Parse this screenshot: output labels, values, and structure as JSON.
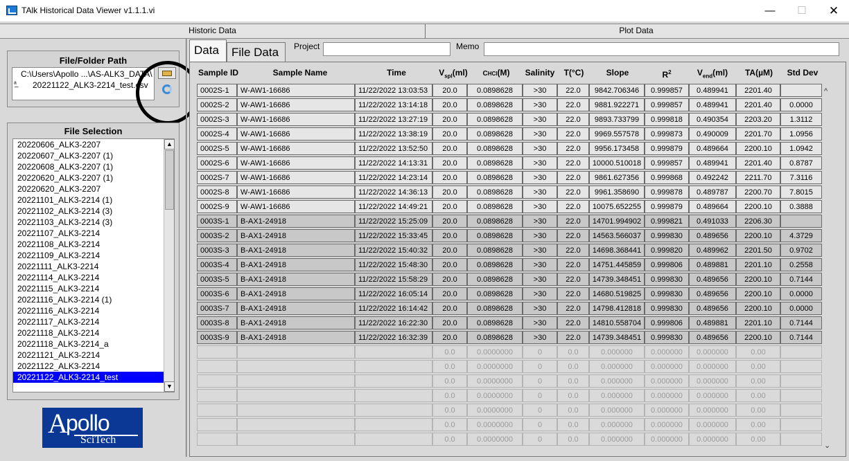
{
  "window": {
    "title": "TAlk Historical Data Viewer v1.1.1.vi",
    "minimize": "—",
    "maximize": "☐",
    "close": "✕"
  },
  "top_tabs": {
    "historic": "Historic Data",
    "plot": "Plot Data"
  },
  "file_path": {
    "title": "File/Folder Path",
    "line1": "C:\\Users\\Apollo ...\\AS-ALK3_DATA\\",
    "line2": "20221122_ALK3-2214_test.csv",
    "glyph": "ᵃ̲"
  },
  "file_selection": {
    "title": "File Selection",
    "items": [
      "20220606_ALK3-2207",
      "20220607_ALK3-2207 (1)",
      "20220608_ALK3-2207 (1)",
      "20220620_ALK3-2207 (1)",
      "20220620_ALK3-2207",
      "20221101_ALK3-2214 (1)",
      "20221102_ALK3-2214 (3)",
      "20221103_ALK3-2214 (3)",
      "20221107_ALK3-2214",
      "20221108_ALK3-2214",
      "20221109_ALK3-2214",
      "20221111_ALK3-2214",
      "20221114_ALK3-2214",
      "20221115_ALK3-2214",
      "20221116_ALK3-2214 (1)",
      "20221116_ALK3-2214",
      "20221117_ALK3-2214",
      "20221118_ALK3-2214",
      "20221118_ALK3-2214_a",
      "20221121_ALK3-2214",
      "20221122_ALK3-2214",
      "20221122_ALK3-2214_test"
    ],
    "selected": "20221122_ALK3-2214_test",
    "scroll_up": "▲",
    "scroll_down": "▼"
  },
  "logo": {
    "a": "A",
    "pollo": "pollo",
    "sci": "SciTech"
  },
  "data_tabs": {
    "data": "Data",
    "file_data": "File Data"
  },
  "fields": {
    "project_label": "Project",
    "project_value": "",
    "memo_label": "Memo",
    "memo_value": ""
  },
  "table": {
    "headers": {
      "sample_id": "Sample ID",
      "sample_name": "Sample Name",
      "time": "Time",
      "vspl_main": "V",
      "vspl_sub": "spl",
      "vspl_unit": "(ml)",
      "chcl_main": "C",
      "chcl_sub": "HCl",
      "chcl_unit": "(M)",
      "salinity": "Salinity",
      "temp": "T(°C)",
      "slope": "Slope",
      "r2_main": "R",
      "r2_sup": "2",
      "vend_main": "V",
      "vend_sub": "end",
      "vend_unit": "(ml)",
      "ta": "TA(µM)",
      "std": "Std Dev"
    },
    "scroll_up": "^",
    "scroll_down": "⌄",
    "rows": [
      {
        "id": "0002S-1",
        "name": "W-AW1-16686",
        "time": "11/22/2022  13:03:53",
        "v": "20.0",
        "c": "0.0898628",
        "sal": ">30",
        "t": "22.0",
        "slope": "9842.706346",
        "r2": "0.999857",
        "vend": "0.489941",
        "ta": "2201.40",
        "std": ""
      },
      {
        "id": "0002S-2",
        "name": "W-AW1-16686",
        "time": "11/22/2022  13:14:18",
        "v": "20.0",
        "c": "0.0898628",
        "sal": ">30",
        "t": "22.0",
        "slope": "9881.922271",
        "r2": "0.999857",
        "vend": "0.489941",
        "ta": "2201.40",
        "std": "0.0000"
      },
      {
        "id": "0002S-3",
        "name": "W-AW1-16686",
        "time": "11/22/2022  13:27:19",
        "v": "20.0",
        "c": "0.0898628",
        "sal": ">30",
        "t": "22.0",
        "slope": "9893.733799",
        "r2": "0.999818",
        "vend": "0.490354",
        "ta": "2203.20",
        "std": "1.3112"
      },
      {
        "id": "0002S-4",
        "name": "W-AW1-16686",
        "time": "11/22/2022  13:38:19",
        "v": "20.0",
        "c": "0.0898628",
        "sal": ">30",
        "t": "22.0",
        "slope": "9969.557578",
        "r2": "0.999873",
        "vend": "0.490009",
        "ta": "2201.70",
        "std": "1.0956"
      },
      {
        "id": "0002S-5",
        "name": "W-AW1-16686",
        "time": "11/22/2022  13:52:50",
        "v": "20.0",
        "c": "0.0898628",
        "sal": ">30",
        "t": "22.0",
        "slope": "9956.173458",
        "r2": "0.999879",
        "vend": "0.489664",
        "ta": "2200.10",
        "std": "1.0942"
      },
      {
        "id": "0002S-6",
        "name": "W-AW1-16686",
        "time": "11/22/2022  14:13:31",
        "v": "20.0",
        "c": "0.0898628",
        "sal": ">30",
        "t": "22.0",
        "slope": "10000.510018",
        "r2": "0.999857",
        "vend": "0.489941",
        "ta": "2201.40",
        "std": "0.8787"
      },
      {
        "id": "0002S-7",
        "name": "W-AW1-16686",
        "time": "11/22/2022  14:23:14",
        "v": "20.0",
        "c": "0.0898628",
        "sal": ">30",
        "t": "22.0",
        "slope": "9861.627356",
        "r2": "0.999868",
        "vend": "0.492242",
        "ta": "2211.70",
        "std": "7.3116"
      },
      {
        "id": "0002S-8",
        "name": "W-AW1-16686",
        "time": "11/22/2022  14:36:13",
        "v": "20.0",
        "c": "0.0898628",
        "sal": ">30",
        "t": "22.0",
        "slope": "9961.358690",
        "r2": "0.999878",
        "vend": "0.489787",
        "ta": "2200.70",
        "std": "7.8015"
      },
      {
        "id": "0002S-9",
        "name": "W-AW1-16686",
        "time": "11/22/2022  14:49:21",
        "v": "20.0",
        "c": "0.0898628",
        "sal": ">30",
        "t": "22.0",
        "slope": "10075.652255",
        "r2": "0.999879",
        "vend": "0.489664",
        "ta": "2200.10",
        "std": "0.3888"
      },
      {
        "id": "0003S-1",
        "name": "B-AX1-24918",
        "time": "11/22/2022  15:25:09",
        "v": "20.0",
        "c": "0.0898628",
        "sal": ">30",
        "t": "22.0",
        "slope": "14701.994902",
        "r2": "0.999821",
        "vend": "0.491033",
        "ta": "2206.30",
        "std": ""
      },
      {
        "id": "0003S-2",
        "name": "B-AX1-24918",
        "time": "11/22/2022  15:33:45",
        "v": "20.0",
        "c": "0.0898628",
        "sal": ">30",
        "t": "22.0",
        "slope": "14563.566037",
        "r2": "0.999830",
        "vend": "0.489656",
        "ta": "2200.10",
        "std": "4.3729"
      },
      {
        "id": "0003S-3",
        "name": "B-AX1-24918",
        "time": "11/22/2022  15:40:32",
        "v": "20.0",
        "c": "0.0898628",
        "sal": ">30",
        "t": "22.0",
        "slope": "14698.368441",
        "r2": "0.999820",
        "vend": "0.489962",
        "ta": "2201.50",
        "std": "0.9702"
      },
      {
        "id": "0003S-4",
        "name": "B-AX1-24918",
        "time": "11/22/2022  15:48:30",
        "v": "20.0",
        "c": "0.0898628",
        "sal": ">30",
        "t": "22.0",
        "slope": "14751.445859",
        "r2": "0.999806",
        "vend": "0.489881",
        "ta": "2201.10",
        "std": "0.2558"
      },
      {
        "id": "0003S-5",
        "name": "B-AX1-24918",
        "time": "11/22/2022  15:58:29",
        "v": "20.0",
        "c": "0.0898628",
        "sal": ">30",
        "t": "22.0",
        "slope": "14739.348451",
        "r2": "0.999830",
        "vend": "0.489656",
        "ta": "2200.10",
        "std": "0.7144"
      },
      {
        "id": "0003S-6",
        "name": "B-AX1-24918",
        "time": "11/22/2022  16:05:14",
        "v": "20.0",
        "c": "0.0898628",
        "sal": ">30",
        "t": "22.0",
        "slope": "14680.519825",
        "r2": "0.999830",
        "vend": "0.489656",
        "ta": "2200.10",
        "std": "0.0000"
      },
      {
        "id": "0003S-7",
        "name": "B-AX1-24918",
        "time": "11/22/2022  16:14:42",
        "v": "20.0",
        "c": "0.0898628",
        "sal": ">30",
        "t": "22.0",
        "slope": "14798.412818",
        "r2": "0.999830",
        "vend": "0.489656",
        "ta": "2200.10",
        "std": "0.0000"
      },
      {
        "id": "0003S-8",
        "name": "B-AX1-24918",
        "time": "11/22/2022  16:22:30",
        "v": "20.0",
        "c": "0.0898628",
        "sal": ">30",
        "t": "22.0",
        "slope": "14810.558704",
        "r2": "0.999806",
        "vend": "0.489881",
        "ta": "2201.10",
        "std": "0.7144"
      },
      {
        "id": "0003S-9",
        "name": "B-AX1-24918",
        "time": "11/22/2022  16:32:39",
        "v": "20.0",
        "c": "0.0898628",
        "sal": ">30",
        "t": "22.0",
        "slope": "14739.348451",
        "r2": "0.999830",
        "vend": "0.489656",
        "ta": "2200.10",
        "std": "0.7144"
      }
    ],
    "empty_row": {
      "id": "",
      "name": "",
      "time": "",
      "v": "0.0",
      "c": "0.0000000",
      "sal": "0",
      "t": "0.0",
      "slope": "0.000000",
      "r2": "0.000000",
      "vend": "0.000000",
      "ta": "0.00",
      "std": ""
    },
    "empty_rows": 7
  }
}
